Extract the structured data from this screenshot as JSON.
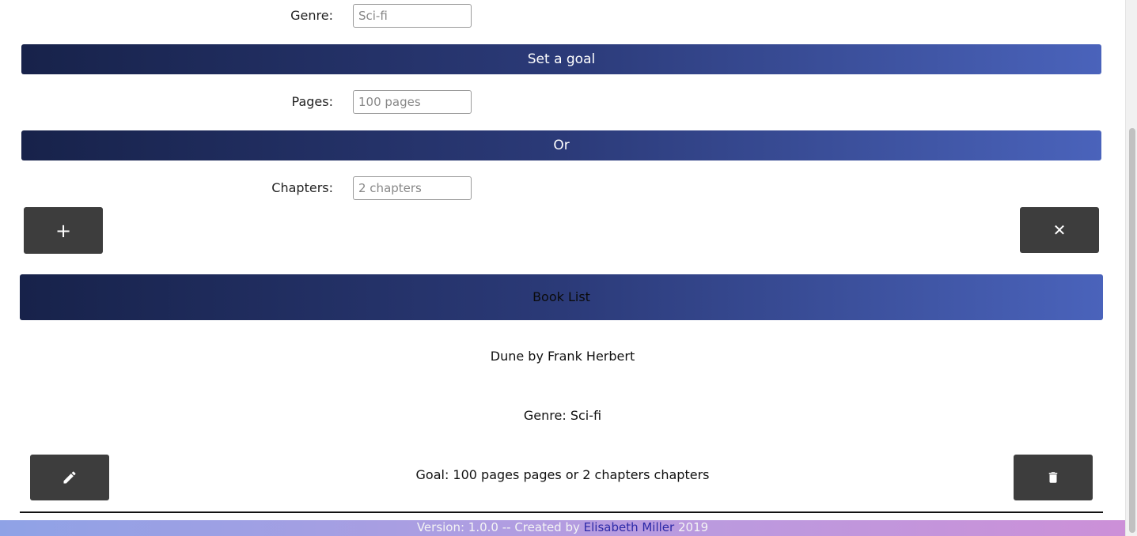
{
  "form": {
    "genre": {
      "label": "Genre:",
      "placeholder": "Sci-fi"
    },
    "goal_header": "Set a goal",
    "pages": {
      "label": "Pages:",
      "placeholder": "100 pages"
    },
    "or_header": "Or",
    "chapters": {
      "label": "Chapters:",
      "placeholder": "2 chapters"
    },
    "add_button_symbol": "+",
    "close_button_symbol": "✕"
  },
  "booklist": {
    "header": "Book List",
    "items": [
      {
        "title_line": "Dune by Frank Herbert",
        "genre_line": "Genre: Sci-fi",
        "goal_line": "Goal: 100 pages pages or 2 chapters chapters"
      }
    ]
  },
  "footer": {
    "prefix": "Version: 1.0.0 -- Created by ",
    "author": "Elisabeth Miller",
    "year": " 2019"
  },
  "icons": {
    "add": "plus-icon",
    "close": "close-icon",
    "edit": "pencil-icon",
    "delete": "trash-icon"
  }
}
